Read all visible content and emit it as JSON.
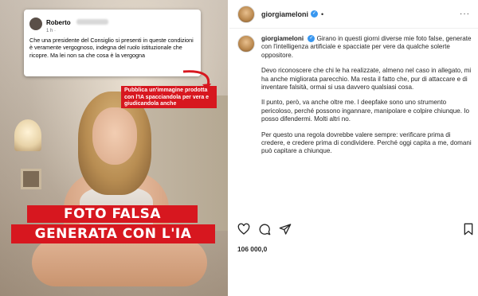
{
  "left_image": {
    "facebook_post": {
      "author": "Roberto",
      "time": "1 h · ",
      "text": "Che una presidente del Consiglio  si presenti in queste condizioni è veramente vergognoso, indegna del ruolo istituzionale che ricopre. Ma lei non sa che cosa è la vergogna"
    },
    "callout": "Pubblica un'immagine prodotta con l'IA spacciandola per vera e giudicandola anche",
    "banner_line1": "FOTO FALSA",
    "banner_line2": "GENERATA CON L'IA"
  },
  "instagram": {
    "header": {
      "username": "giorgiameloni",
      "verified_icon": "verified-badge-icon",
      "separator": "•",
      "more_icon": "ellipsis-icon",
      "more_label": "···"
    },
    "caption": {
      "username": "giorgiameloni",
      "paragraphs": [
        "Girano in questi giorni diverse mie foto false, generate con l'intelligenza artificiale e spacciate per vere da qualche solerte oppositore.",
        "Devo riconoscere che chi le ha realizzate, almeno nel caso in allegato, mi ha anche migliorata parecchio. Ma resta il fatto che, pur di attaccare e di inventare falsità, ormai si usa davvero qualsiasi cosa.",
        "Il punto, però, va anche oltre me. I deepfake sono uno strumento pericoloso, perché possono ingannare, manipolare e colpire chiunque. Io posso difendermi. Molti altri no.",
        "Per questo una regola dovrebbe valere sempre: verificare prima di credere, e credere prima di condividere. Perché oggi capita a me, domani può capitare a chiunque."
      ]
    },
    "actions": [
      "heart-icon",
      "comment-icon",
      "share-icon",
      "bookmark-icon"
    ],
    "likes": "106 000,0"
  },
  "colors": {
    "banner_red": "#d7171f",
    "verified_blue": "#3897f0"
  }
}
